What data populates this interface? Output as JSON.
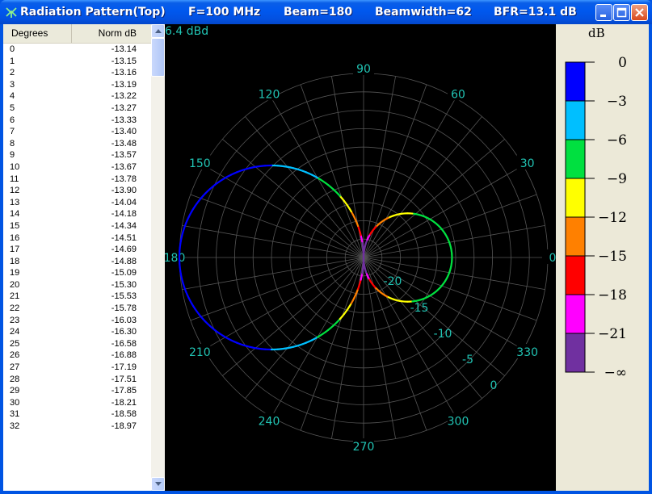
{
  "window": {
    "title_segments": [
      "Radiation Pattern(Top)",
      "F=100 MHz",
      "Beam=180",
      "Beamwidth=62",
      "BFR=13.1 dB"
    ]
  },
  "list": {
    "columns": [
      "Degrees",
      "Norm dB"
    ],
    "rows": [
      [
        "0",
        "-13.14"
      ],
      [
        "1",
        "-13.15"
      ],
      [
        "2",
        "-13.16"
      ],
      [
        "3",
        "-13.19"
      ],
      [
        "4",
        "-13.22"
      ],
      [
        "5",
        "-13.27"
      ],
      [
        "6",
        "-13.33"
      ],
      [
        "7",
        "-13.40"
      ],
      [
        "8",
        "-13.48"
      ],
      [
        "9",
        "-13.57"
      ],
      [
        "10",
        "-13.67"
      ],
      [
        "11",
        "-13.78"
      ],
      [
        "12",
        "-13.90"
      ],
      [
        "13",
        "-14.04"
      ],
      [
        "14",
        "-14.18"
      ],
      [
        "15",
        "-14.34"
      ],
      [
        "16",
        "-14.51"
      ],
      [
        "17",
        "-14.69"
      ],
      [
        "18",
        "-14.88"
      ],
      [
        "19",
        "-15.09"
      ],
      [
        "20",
        "-15.30"
      ],
      [
        "21",
        "-15.53"
      ],
      [
        "22",
        "-15.78"
      ],
      [
        "23",
        "-16.03"
      ],
      [
        "24",
        "-16.30"
      ],
      [
        "25",
        "-16.58"
      ],
      [
        "26",
        "-16.88"
      ],
      [
        "27",
        "-17.19"
      ],
      [
        "28",
        "-17.51"
      ],
      [
        "29",
        "-17.85"
      ],
      [
        "30",
        "-18.21"
      ],
      [
        "31",
        "-18.58"
      ],
      [
        "32",
        "-18.97"
      ]
    ]
  },
  "plot": {
    "gain_label": "6.4 dBd",
    "angle_labels": [
      "0",
      "30",
      "60",
      "90",
      "120",
      "150",
      "180",
      "210",
      "240",
      "270",
      "300",
      "330"
    ],
    "radial_labels": [
      "-20",
      "-15",
      "-10",
      "-5",
      "0"
    ],
    "label_color": "#21c4b4",
    "grid_color": "#555555"
  },
  "legend": {
    "unit": "dB",
    "ticks": [
      "0",
      "−3",
      "−6",
      "−9",
      "−12",
      "−15",
      "−18",
      "−21",
      "−∞"
    ],
    "colors": [
      "#0000ff",
      "#00bfff",
      "#00e040",
      "#ffff00",
      "#ff8000",
      "#ff0000",
      "#ff00ff",
      "#7030a0"
    ]
  }
}
